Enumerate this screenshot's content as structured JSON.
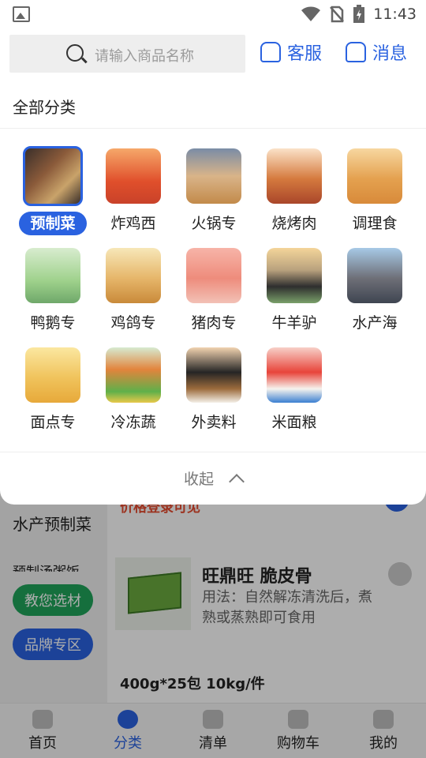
{
  "status_bar": {
    "time": "11:43"
  },
  "header": {
    "search_placeholder": "请输入商品名称",
    "service_label": "客服",
    "message_label": "消息"
  },
  "panel": {
    "title": "全部分类",
    "categories": [
      {
        "label": "预制菜",
        "selected": true
      },
      {
        "label": "炸鸡西"
      },
      {
        "label": "火锅专"
      },
      {
        "label": "烧烤肉"
      },
      {
        "label": "调理食"
      },
      {
        "label": "鸭鹅专"
      },
      {
        "label": "鸡鸽专"
      },
      {
        "label": "猪肉专"
      },
      {
        "label": "牛羊驴"
      },
      {
        "label": "水产海"
      },
      {
        "label": "面点专"
      },
      {
        "label": "冷冻蔬"
      },
      {
        "label": "外卖料"
      },
      {
        "label": "米面粮"
      }
    ],
    "collapse_label": "收起"
  },
  "background": {
    "price_note": "价格登录可见",
    "left_categories": [
      "水产预制菜",
      "预制汤粥饭"
    ],
    "pill_green": "教您选材",
    "pill_blue": "品牌专区",
    "product": {
      "title": "旺鼎旺 脆皮骨",
      "desc": "用法：自然解冻清洗后，煮熟或蒸熟即可食用",
      "spec": "400g*25包 10kg/件"
    }
  },
  "bottom_nav": [
    {
      "label": "首页"
    },
    {
      "label": "分类",
      "active": true
    },
    {
      "label": "清单"
    },
    {
      "label": "购物车"
    },
    {
      "label": "我的"
    }
  ],
  "colors": {
    "accent": "#2a62e0",
    "price": "#e64a2e",
    "green": "#1fa45a"
  }
}
